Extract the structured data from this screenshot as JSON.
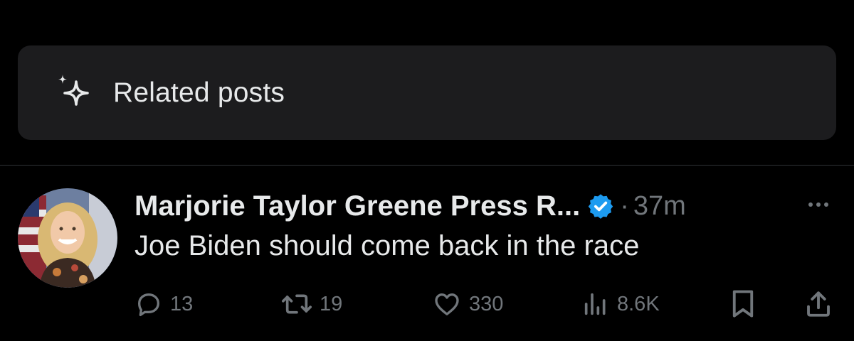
{
  "related": {
    "label": "Related posts",
    "icon": "sparkle-icon"
  },
  "post": {
    "author": "Marjorie Taylor Greene Press R...",
    "verified": true,
    "separator": "·",
    "time": "37m",
    "text": "Joe Biden should come back in the race",
    "actions": {
      "replies": "13",
      "reposts": "19",
      "likes": "330",
      "views": "8.6K"
    }
  },
  "colors": {
    "background": "#000000",
    "card": "#1c1c1e",
    "text": "#e7e9ea",
    "muted": "#71767b",
    "verified": "#1d9bf0",
    "divider": "#2f3336"
  }
}
